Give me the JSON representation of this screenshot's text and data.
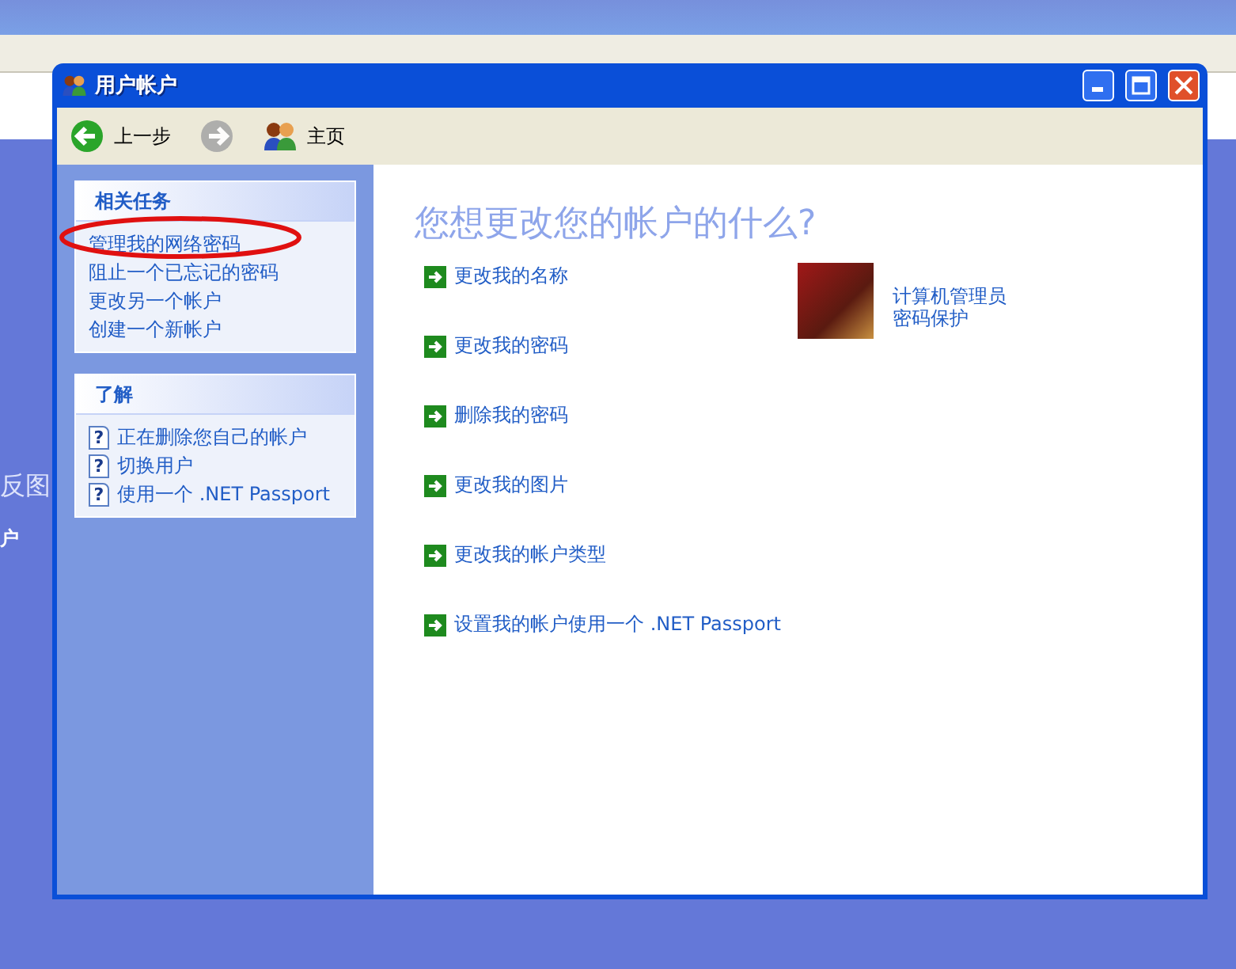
{
  "background": {
    "texts": [
      "反图",
      "户"
    ]
  },
  "window": {
    "title": "用户帐户"
  },
  "toolbar": [
    {
      "kind": "back",
      "label": "上一步",
      "disabled": false
    },
    {
      "kind": "forward",
      "disabled": true
    },
    {
      "kind": "home",
      "label": "主页",
      "disabled": false
    }
  ],
  "sidebar": {
    "panels": [
      {
        "title": "相关任务",
        "items": [
          {
            "kind": "link",
            "label": "管理我的网络密码"
          },
          {
            "kind": "link",
            "label": "阻止一个已忘记的密码"
          },
          {
            "kind": "link",
            "label": "更改另一个帐户"
          },
          {
            "kind": "link",
            "label": "创建一个新帐户"
          }
        ]
      },
      {
        "title": "了解",
        "items": [
          {
            "kind": "help",
            "icon": "?",
            "label": "正在删除您自己的帐户"
          },
          {
            "kind": "help",
            "icon": "?",
            "label": "切换用户"
          },
          {
            "kind": "help",
            "icon": "?",
            "label": "使用一个 .NET Passport"
          }
        ]
      }
    ]
  },
  "main": {
    "heading": "您想更改您的帐户的什么?",
    "tasks": [
      "更改我的名称",
      "更改我的密码",
      "删除我的密码",
      "更改我的图片",
      "更改我的帐户类型",
      "设置我的帐户使用一个 .NET Passport"
    ],
    "account": {
      "name": "计算机管理员",
      "status": "密码保护"
    }
  }
}
